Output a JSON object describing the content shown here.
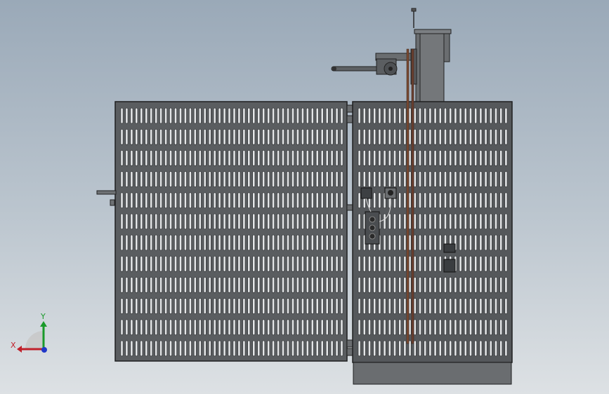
{
  "viewport": {
    "background_top": "#9aa9b8",
    "background_bottom": "#dde1e4"
  },
  "model": {
    "panel_color": "#5a5d60",
    "slot_color": "#e4e6e8",
    "edge_color": "#1e1f20",
    "rod_color": "#7a4a32",
    "base_color": "#6a6d70"
  },
  "triad": {
    "x_label": "X",
    "y_label": "Y",
    "x_color": "#c0202a",
    "y_color": "#1a9a2a",
    "z_color": "#2038c8"
  }
}
